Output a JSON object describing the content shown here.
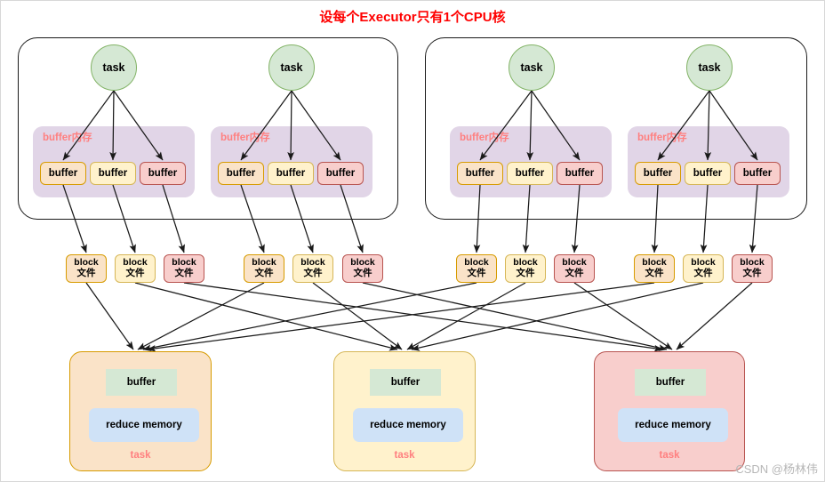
{
  "title": "设每个Executor只有1个CPU核",
  "watermark": "CSDN @杨林伟",
  "labels": {
    "task": "task",
    "buffer": "buffer",
    "buffer_memory": "buffer内存",
    "block_line1": "block",
    "block_line2": "文件",
    "reduce_memory": "reduce memory"
  },
  "colors": {
    "orange_fill": "#fae3c8",
    "orange_stroke": "#d79b00",
    "yellow_fill": "#fff2cc",
    "yellow_stroke": "#d6b656",
    "red_fill": "#f8cecc",
    "red_stroke": "#b85450",
    "green_fill": "#d5e8d4",
    "green_stroke": "#82b366",
    "purple_fill": "#e1d5e7",
    "blue_fill": "#cfe2f7",
    "title_color": "#ff0000",
    "label_color": "#ff7f7f",
    "edge_color": "#1a1a1a"
  },
  "executors": [
    {
      "name": "executor-1",
      "tasks": [
        {
          "name": "map-task-1",
          "task_label": "task",
          "buffer_group_label": "buffer内存",
          "buffers": [
            {
              "label": "buffer",
              "color": "orange"
            },
            {
              "label": "buffer",
              "color": "yellow"
            },
            {
              "label": "buffer",
              "color": "red"
            }
          ],
          "blocks": [
            {
              "line1": "block",
              "line2": "文件",
              "color": "orange"
            },
            {
              "line1": "block",
              "line2": "文件",
              "color": "yellow"
            },
            {
              "line1": "block",
              "line2": "文件",
              "color": "red"
            }
          ]
        },
        {
          "name": "map-task-2",
          "task_label": "task",
          "buffer_group_label": "buffer内存",
          "buffers": [
            {
              "label": "buffer",
              "color": "orange"
            },
            {
              "label": "buffer",
              "color": "yellow"
            },
            {
              "label": "buffer",
              "color": "red"
            }
          ],
          "blocks": [
            {
              "line1": "block",
              "line2": "文件",
              "color": "orange"
            },
            {
              "line1": "block",
              "line2": "文件",
              "color": "yellow"
            },
            {
              "line1": "block",
              "line2": "文件",
              "color": "red"
            }
          ]
        }
      ]
    },
    {
      "name": "executor-2",
      "tasks": [
        {
          "name": "map-task-3",
          "task_label": "task",
          "buffer_group_label": "buffer内存",
          "buffers": [
            {
              "label": "buffer",
              "color": "orange"
            },
            {
              "label": "buffer",
              "color": "yellow"
            },
            {
              "label": "buffer",
              "color": "red"
            }
          ],
          "blocks": [
            {
              "line1": "block",
              "line2": "文件",
              "color": "orange"
            },
            {
              "line1": "block",
              "line2": "文件",
              "color": "yellow"
            },
            {
              "line1": "block",
              "line2": "文件",
              "color": "red"
            }
          ]
        },
        {
          "name": "map-task-4",
          "task_label": "task",
          "buffer_group_label": "buffer内存",
          "buffers": [
            {
              "label": "buffer",
              "color": "orange"
            },
            {
              "label": "buffer",
              "color": "yellow"
            },
            {
              "label": "buffer",
              "color": "red"
            }
          ],
          "blocks": [
            {
              "line1": "block",
              "line2": "文件",
              "color": "orange"
            },
            {
              "line1": "block",
              "line2": "文件",
              "color": "yellow"
            },
            {
              "line1": "block",
              "line2": "文件",
              "color": "red"
            }
          ]
        }
      ]
    }
  ],
  "reduce_tasks": [
    {
      "name": "reduce-task-1",
      "color": "orange",
      "buffer_label": "buffer",
      "memory_label": "reduce memory",
      "task_label": "task"
    },
    {
      "name": "reduce-task-2",
      "color": "yellow",
      "buffer_label": "buffer",
      "memory_label": "reduce memory",
      "task_label": "task"
    },
    {
      "name": "reduce-task-3",
      "color": "red",
      "buffer_label": "buffer",
      "memory_label": "reduce memory",
      "task_label": "task"
    }
  ]
}
